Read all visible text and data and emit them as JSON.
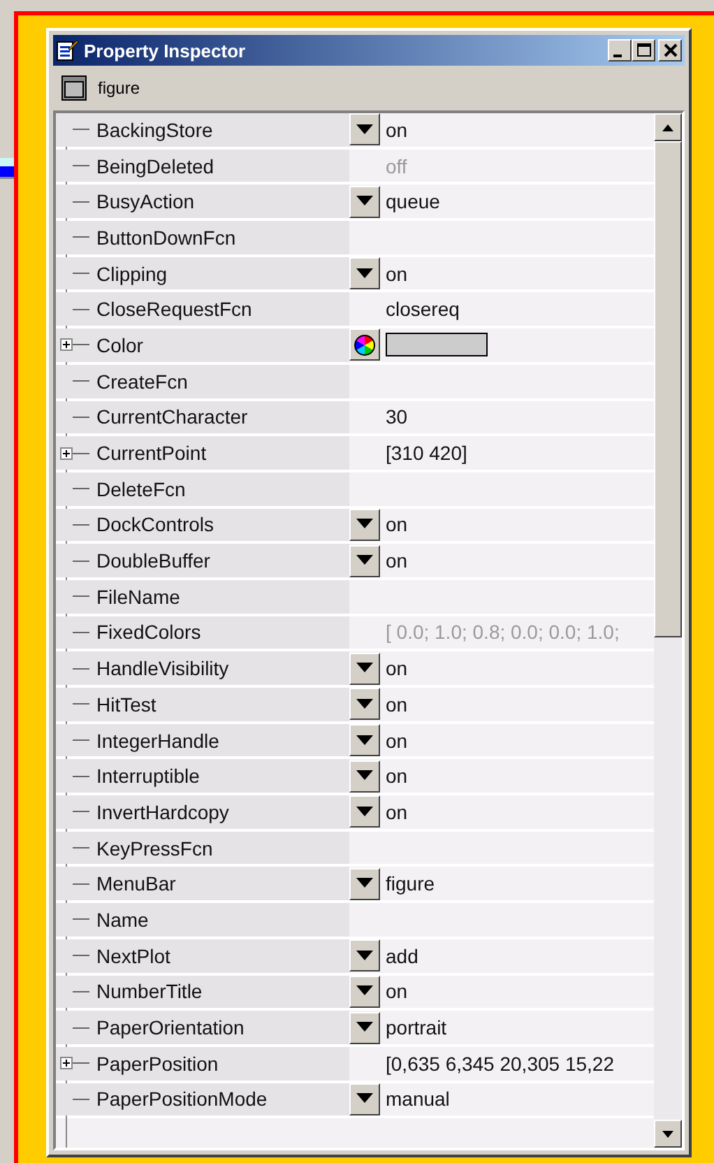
{
  "window": {
    "title": "Property Inspector"
  },
  "object": {
    "label": "figure"
  },
  "properties": [
    {
      "name": "BackingStore",
      "expandable": false,
      "kind": "dropdown",
      "value": "on",
      "disabled": false
    },
    {
      "name": "BeingDeleted",
      "expandable": false,
      "kind": "text",
      "value": "off",
      "disabled": true
    },
    {
      "name": "BusyAction",
      "expandable": false,
      "kind": "dropdown",
      "value": "queue",
      "disabled": false
    },
    {
      "name": "ButtonDownFcn",
      "expandable": false,
      "kind": "text"
    },
    {
      "name": "Clipping",
      "expandable": false,
      "kind": "dropdown",
      "value": "on",
      "disabled": false
    },
    {
      "name": "CloseRequestFcn",
      "expandable": false,
      "kind": "text",
      "value": "closereq",
      "disabled": false
    },
    {
      "name": "Color",
      "expandable": true,
      "kind": "color",
      "color": "#cccccc"
    },
    {
      "name": "CreateFcn",
      "expandable": false,
      "kind": "text"
    },
    {
      "name": "CurrentCharacter",
      "expandable": false,
      "kind": "text",
      "value": "30",
      "disabled": false
    },
    {
      "name": "CurrentPoint",
      "expandable": true,
      "kind": "text",
      "value": "[310 420]",
      "disabled": false
    },
    {
      "name": "DeleteFcn",
      "expandable": false,
      "kind": "text"
    },
    {
      "name": "DockControls",
      "expandable": false,
      "kind": "dropdown",
      "value": "on",
      "disabled": false
    },
    {
      "name": "DoubleBuffer",
      "expandable": false,
      "kind": "dropdown",
      "value": "on",
      "disabled": false
    },
    {
      "name": "FileName",
      "expandable": false,
      "kind": "text"
    },
    {
      "name": "FixedColors",
      "expandable": false,
      "kind": "text",
      "value": "[ 0.0; 1.0; 0.8; 0.0; 0.0; 1.0;",
      "disabled": true
    },
    {
      "name": "HandleVisibility",
      "expandable": false,
      "kind": "dropdown",
      "value": "on",
      "disabled": false
    },
    {
      "name": "HitTest",
      "expandable": false,
      "kind": "dropdown",
      "value": "on",
      "disabled": false
    },
    {
      "name": "IntegerHandle",
      "expandable": false,
      "kind": "dropdown",
      "value": "on",
      "disabled": false
    },
    {
      "name": "Interruptible",
      "expandable": false,
      "kind": "dropdown",
      "value": "on",
      "disabled": false
    },
    {
      "name": "InvertHardcopy",
      "expandable": false,
      "kind": "dropdown",
      "value": "on",
      "disabled": false
    },
    {
      "name": "KeyPressFcn",
      "expandable": false,
      "kind": "text"
    },
    {
      "name": "MenuBar",
      "expandable": false,
      "kind": "dropdown",
      "value": "figure",
      "disabled": false
    },
    {
      "name": "Name",
      "expandable": false,
      "kind": "text"
    },
    {
      "name": "NextPlot",
      "expandable": false,
      "kind": "dropdown",
      "value": "add",
      "disabled": false
    },
    {
      "name": "NumberTitle",
      "expandable": false,
      "kind": "dropdown",
      "value": "on",
      "disabled": false
    },
    {
      "name": "PaperOrientation",
      "expandable": false,
      "kind": "dropdown",
      "value": "portrait",
      "disabled": false
    },
    {
      "name": "PaperPosition",
      "expandable": true,
      "kind": "text",
      "value": "[0,635 6,345 20,305 15,22",
      "disabled": false
    },
    {
      "name": "PaperPositionMode",
      "expandable": false,
      "kind": "dropdown",
      "value": "manual",
      "disabled": false
    }
  ]
}
